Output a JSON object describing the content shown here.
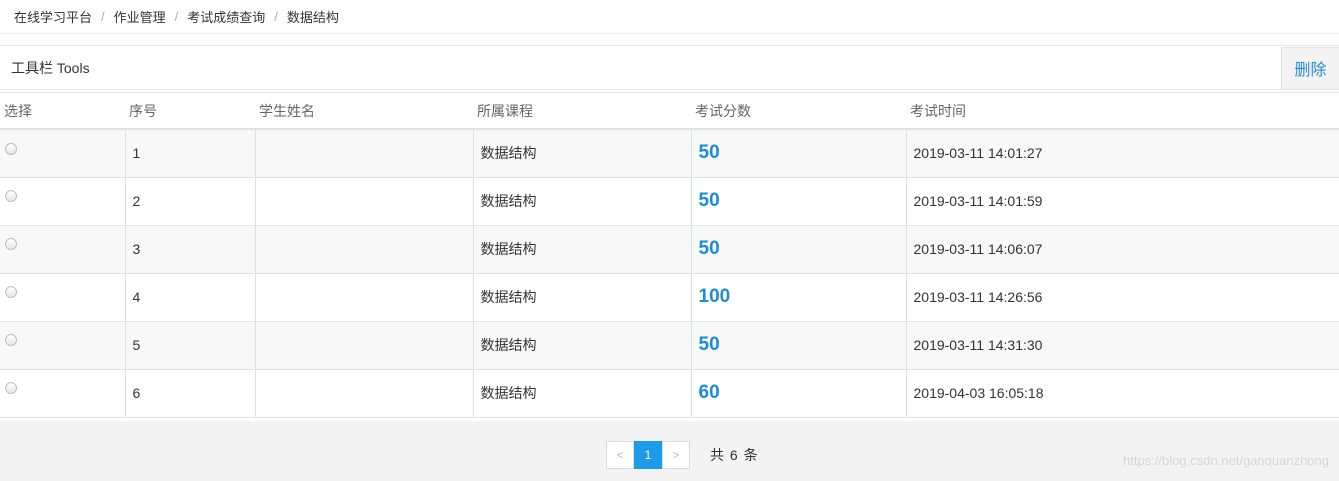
{
  "breadcrumb": [
    "在线学习平台",
    "作业管理",
    "考试成绩查询",
    "数据结构"
  ],
  "toolbar": {
    "title": "工具栏 Tools",
    "delete_label": "删除"
  },
  "table": {
    "headers": [
      "选择",
      "序号",
      "学生姓名",
      "所属课程",
      "考试分数",
      "考试时间"
    ],
    "rows": [
      {
        "index": "1",
        "name": "",
        "course": "数据结构",
        "score": "50",
        "time": "2019-03-11 14:01:27"
      },
      {
        "index": "2",
        "name": "",
        "course": "数据结构",
        "score": "50",
        "time": "2019-03-11 14:01:59"
      },
      {
        "index": "3",
        "name": "",
        "course": "数据结构",
        "score": "50",
        "time": "2019-03-11 14:06:07"
      },
      {
        "index": "4",
        "name": "",
        "course": "数据结构",
        "score": "100",
        "time": "2019-03-11 14:26:56"
      },
      {
        "index": "5",
        "name": "",
        "course": "数据结构",
        "score": "50",
        "time": "2019-03-11 14:31:30"
      },
      {
        "index": "6",
        "name": "",
        "course": "数据结构",
        "score": "60",
        "time": "2019-04-03 16:05:18"
      }
    ]
  },
  "pagination": {
    "prev": "<",
    "page": "1",
    "next": ">",
    "total": "共 6 条"
  },
  "watermark": "https://blog.csdn.net/ganquanzhong"
}
